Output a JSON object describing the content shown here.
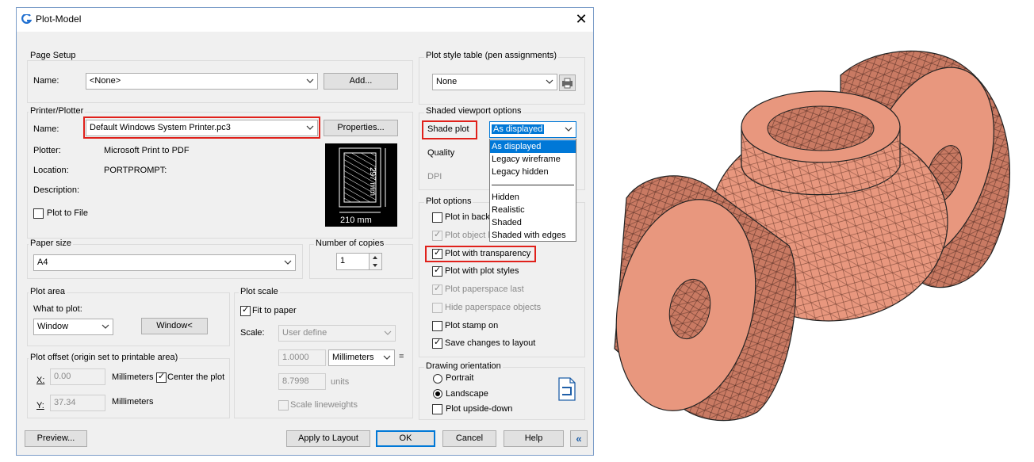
{
  "window": {
    "title": "Plot-Model",
    "close_label": "✕"
  },
  "page_setup": {
    "group": "Page Setup",
    "name_label": "Name:",
    "name_value": "<None>",
    "add_button": "Add..."
  },
  "printer": {
    "group": "Printer/Plotter",
    "name_label": "Name:",
    "name_value": "Default Windows System Printer.pc3",
    "properties_button": "Properties...",
    "plotter_label": "Plotter:",
    "plotter_value": "Microsoft Print to PDF",
    "location_label": "Location:",
    "location_value": "PORTPROMPT:",
    "description_label": "Description:",
    "plot_to_file": "Plot to File",
    "preview_width": "210 mm",
    "preview_height": "297 mm"
  },
  "paper_size": {
    "group": "Paper size",
    "value": "A4"
  },
  "copies": {
    "label": "Number of copies",
    "value": "1"
  },
  "plot_area": {
    "group": "Plot area",
    "what_label": "What to plot:",
    "what_value": "Window",
    "window_button": "Window<"
  },
  "plot_offset": {
    "group": "Plot offset (origin set to printable area)",
    "x_label": "X:",
    "x_value": "0.00",
    "y_label": "Y:",
    "y_value": "37.34",
    "unit": "Millimeters",
    "center": "Center the plot"
  },
  "plot_scale": {
    "group": "Plot scale",
    "fit": "Fit to paper",
    "scale_label": "Scale:",
    "scale_value": "User define",
    "value1": "1.0000",
    "unit_value": "Millimeters",
    "eq": "=",
    "value2": "8.7998",
    "units": "units",
    "lineweights": "Scale lineweights"
  },
  "plot_style": {
    "group": "Plot style table (pen assignments)",
    "value": "None"
  },
  "shaded": {
    "group": "Shaded viewport options",
    "shade_label": "Shade plot",
    "shade_value": "As displayed",
    "quality_label": "Quality",
    "dpi_label": "DPI",
    "options": [
      "As displayed",
      "Legacy wireframe",
      "Legacy hidden",
      "Hidden",
      "Realistic",
      "Shaded",
      "Shaded with edges"
    ]
  },
  "plot_options": {
    "group": "Plot options",
    "items": [
      "Plot in back",
      "Plot object l",
      "Plot with transparency",
      "Plot with plot styles",
      "Plot paperspace last",
      "Hide paperspace objects",
      "Plot stamp on",
      "Save changes to layout"
    ]
  },
  "orientation": {
    "group": "Drawing orientation",
    "portrait": "Portrait",
    "landscape": "Landscape",
    "upside_down": "Plot upside-down"
  },
  "footer": {
    "preview": "Preview...",
    "apply": "Apply to Layout",
    "ok": "OK",
    "cancel": "Cancel",
    "help": "Help",
    "collapse": "«"
  },
  "colors": {
    "accent": "#0078d7",
    "highlight": "#e0211b",
    "model": "#e8977e"
  }
}
